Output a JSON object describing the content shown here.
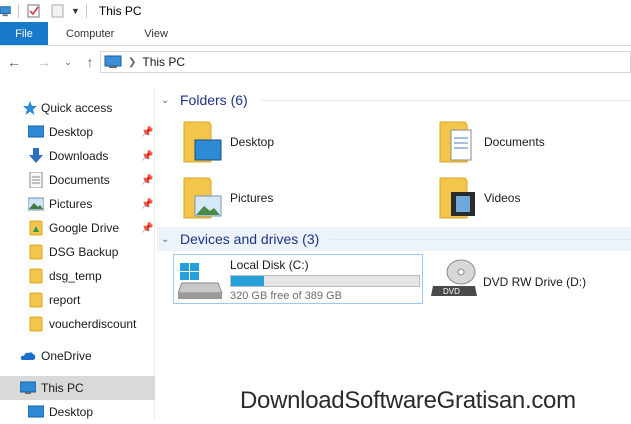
{
  "window": {
    "title": "This PC"
  },
  "ribbon": {
    "tabs": [
      "File",
      "Computer",
      "View"
    ]
  },
  "address": {
    "path": "This PC"
  },
  "nav": {
    "quick_access": "Quick access",
    "items": [
      {
        "label": "Desktop",
        "icon": "desktop-icon",
        "pinned": true
      },
      {
        "label": "Downloads",
        "icon": "downloads-icon",
        "pinned": true
      },
      {
        "label": "Documents",
        "icon": "documents-icon",
        "pinned": true
      },
      {
        "label": "Pictures",
        "icon": "pictures-icon",
        "pinned": true
      },
      {
        "label": "Google Drive",
        "icon": "google-drive-icon",
        "pinned": true
      },
      {
        "label": "DSG Backup",
        "icon": "folder-icon",
        "pinned": false
      },
      {
        "label": "dsg_temp",
        "icon": "folder-icon",
        "pinned": false
      },
      {
        "label": "report",
        "icon": "folder-icon",
        "pinned": false
      },
      {
        "label": "voucherdiscount",
        "icon": "folder-icon",
        "pinned": false
      }
    ],
    "onedrive": "OneDrive",
    "this_pc": "This PC",
    "sub_desktop": "Desktop"
  },
  "folders": {
    "header": "Folders (6)",
    "items": [
      {
        "label": "Desktop",
        "icon": "desktop-folder-icon"
      },
      {
        "label": "Documents",
        "icon": "documents-folder-icon"
      },
      {
        "label": "Pictures",
        "icon": "pictures-folder-icon"
      },
      {
        "label": "Videos",
        "icon": "videos-folder-icon"
      }
    ]
  },
  "devices": {
    "header": "Devices and drives (3)",
    "local_disk": {
      "name": "Local Disk (C:)",
      "free": "320 GB free of 389 GB",
      "used_fraction": 0.177
    },
    "dvd": {
      "name": "DVD RW Drive (D:)",
      "badge": "DVD"
    }
  },
  "watermark": "DownloadSoftwareGratisan.com",
  "colors": {
    "accent": "#1979ca",
    "folder": "#f3c54a",
    "bar": "#26a0da",
    "header_text": "#1e3287"
  }
}
